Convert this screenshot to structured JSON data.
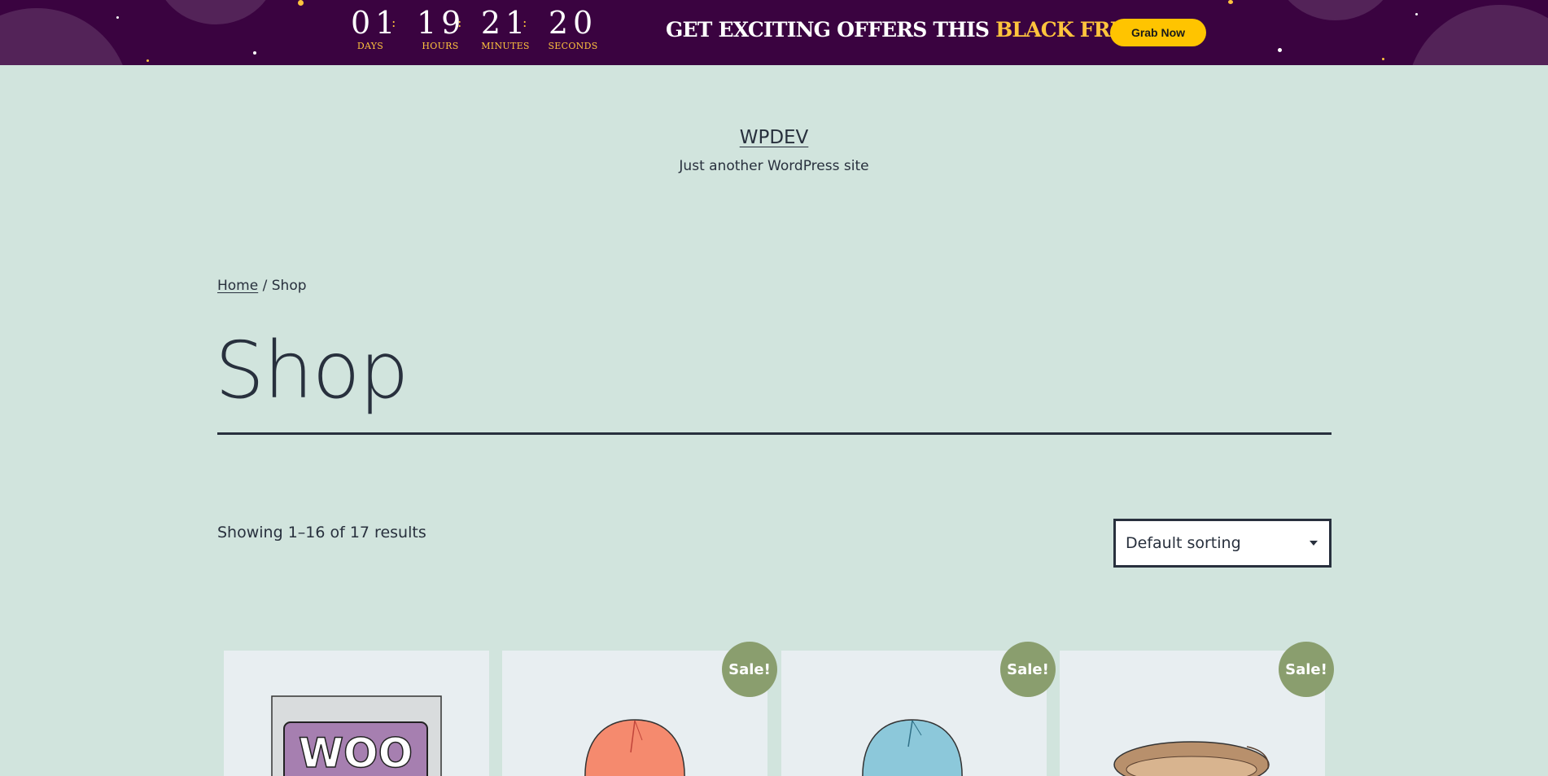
{
  "promo": {
    "countdown": [
      {
        "value": "01",
        "label": "DAYS"
      },
      {
        "value": "19",
        "label": "HOURS"
      },
      {
        "value": "21",
        "label": "MINUTES"
      },
      {
        "value": "20",
        "label": "SECONDS"
      }
    ],
    "offer_text": "GET EXCITING OFFERS THIS ",
    "offer_highlight": "BLACK FRIDAY",
    "cta_label": "Grab Now",
    "background_color": "#3a0340",
    "accent_color": "#ffc43d"
  },
  "site": {
    "title": "WPDEV",
    "tagline": "Just another WordPress site"
  },
  "breadcrumb": {
    "home": "Home",
    "separator": " / ",
    "current": "Shop"
  },
  "page": {
    "title": "Shop"
  },
  "shop": {
    "result_count": "Showing 1–16 of 17 results",
    "sort_selected": "Default sorting",
    "sale_label": "Sale!",
    "products": [
      {
        "image": "woo-poster",
        "on_sale": false
      },
      {
        "image": "beanie-orange",
        "on_sale": true
      },
      {
        "image": "beanie-blue",
        "on_sale": true
      },
      {
        "image": "belt-brown",
        "on_sale": true
      }
    ]
  },
  "colors": {
    "page_background": "#d1e4dd",
    "text": "#28303d",
    "sale_badge": "#8a9e6e"
  }
}
